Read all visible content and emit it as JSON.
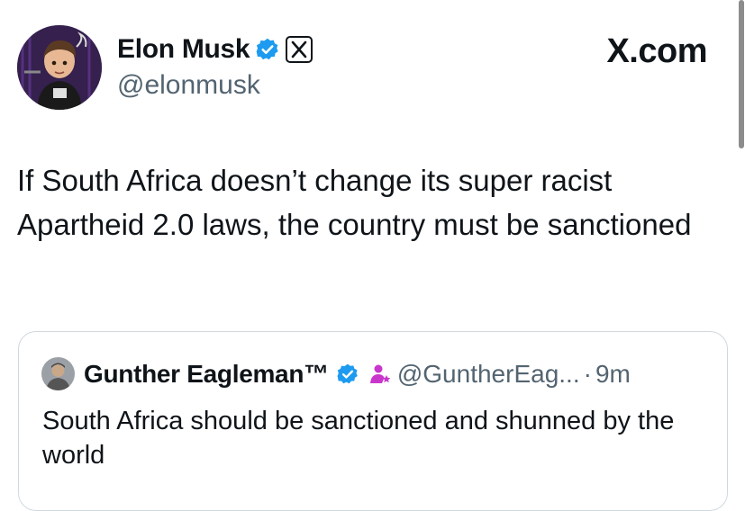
{
  "author": {
    "name": "Elon Musk",
    "handle": "@elonmusk",
    "avatar_icon": "avatar-cartoon-icon",
    "verified_icon": "verified-badge-icon",
    "affiliate_icon": "x-logo-badge-icon"
  },
  "brand": {
    "label": "X.com",
    "logo_icon": "x-logo-icon"
  },
  "tweet": {
    "text": "If South Africa doesn’t change its super racist Apartheid 2.0 laws, the country must be sanctioned"
  },
  "quote": {
    "name": "Gunther Eagleman™",
    "handle": "@GuntherEag...",
    "separator": "·",
    "time": "9m",
    "text": "South Africa should be sanctioned and shunned by the world",
    "verified_icon": "verified-badge-icon",
    "subscriber_icon": "subscriber-icon"
  },
  "colors": {
    "verified_blue": "#1d9bf0",
    "secondary_text": "#536471",
    "border": "#cfd9de",
    "subscriber_pink": "#c936cc"
  }
}
